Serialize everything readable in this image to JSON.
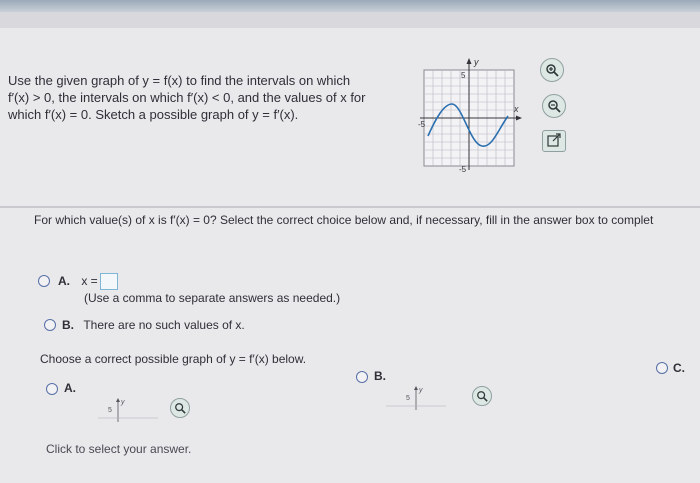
{
  "question": {
    "line1": "Use the given graph of y = f(x) to find the intervals on which",
    "line2": "f′(x) > 0, the intervals on which f′(x) < 0, and the values of x for",
    "line3": "which f′(x) = 0. Sketch a possible graph of y = f′(x)."
  },
  "graph": {
    "y_label": "y",
    "x_label": "x",
    "y_top_tick": "5",
    "y_bottom_tick": "-5",
    "x_left_tick": "-5"
  },
  "part1": {
    "prompt": "For which value(s) of x is f′(x) = 0? Select the correct choice below and, if necessary, fill in the answer box to complet",
    "option_a_letter": "A.",
    "option_a_text": "x =",
    "option_a_hint": "(Use a comma to separate answers as needed.)",
    "option_b_letter": "B.",
    "option_b_text": "There are no such values of x."
  },
  "part2": {
    "prompt": "Choose a correct possible graph of y = f′(x) below.",
    "option_a": "A.",
    "option_b": "B.",
    "option_c": "C.",
    "mini_tick": "5",
    "mini_y": "y"
  },
  "footer": {
    "click_text": "Click to select your answer."
  },
  "colors": {
    "accent": "#5870a8",
    "curve": "#2a6fb0",
    "zoom_bg": "#dde7e3"
  }
}
